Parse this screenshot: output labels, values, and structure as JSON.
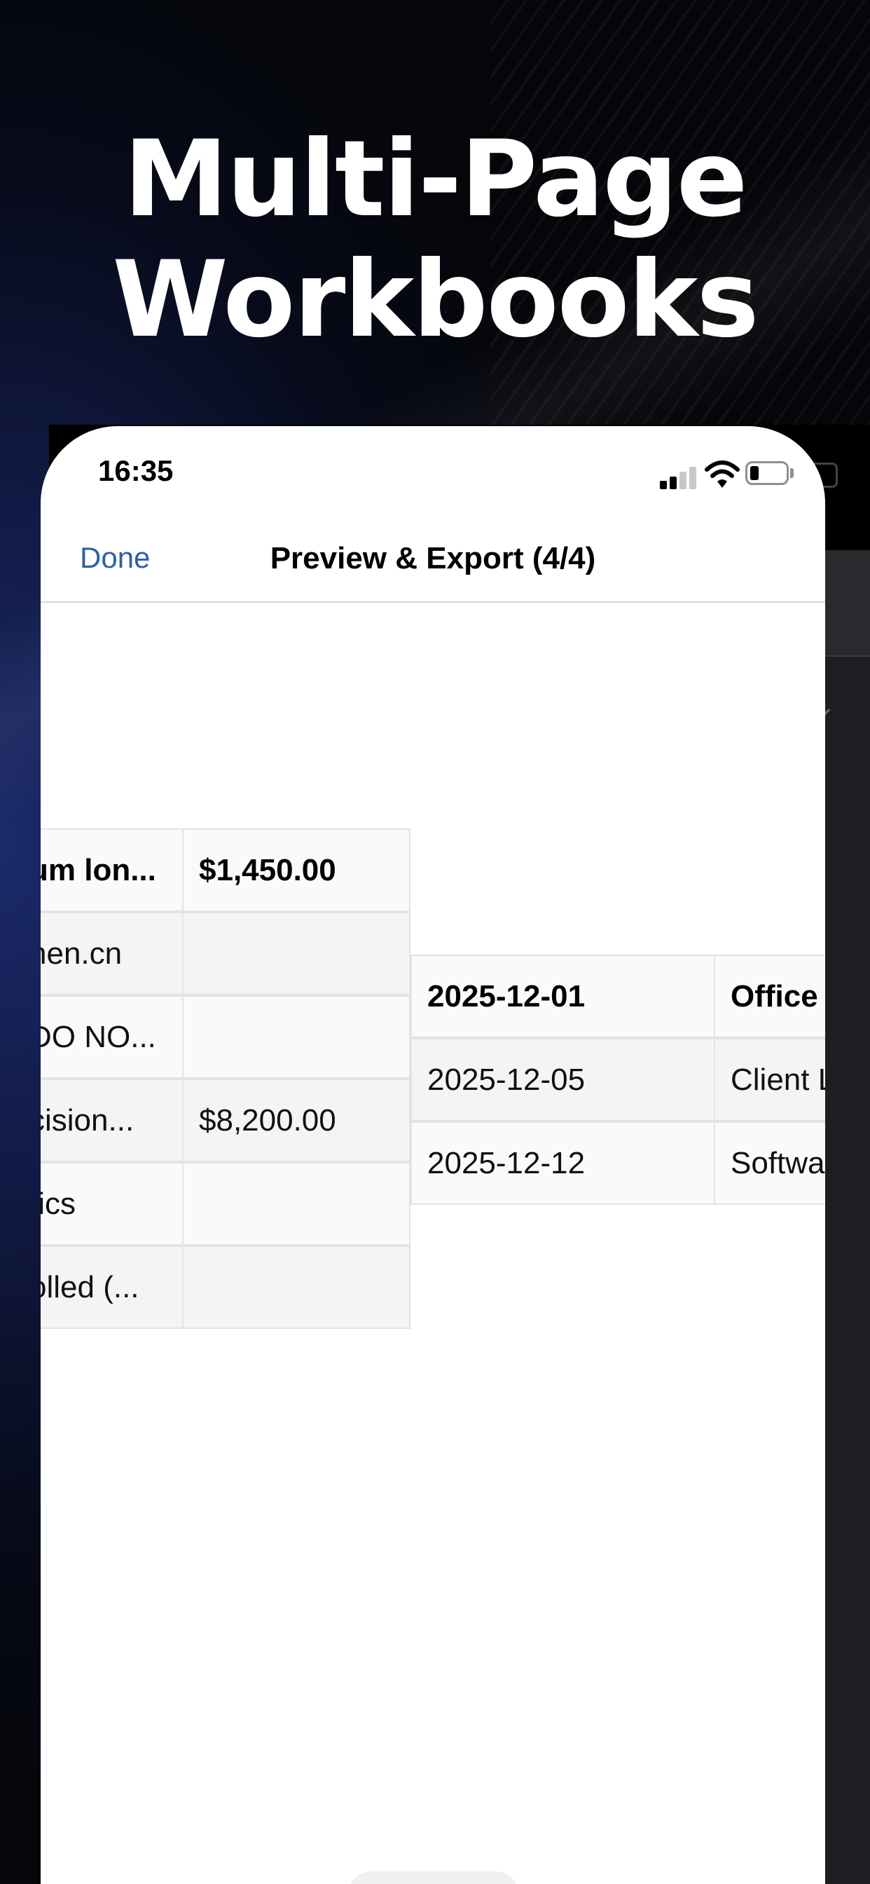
{
  "marketing": {
    "headline_line1": "Multi-Page",
    "headline_line2": "Workbooks"
  },
  "status_bar": {
    "time": "16:35",
    "battery_level": 0.2
  },
  "nav": {
    "done_label": "Done",
    "title": "Preview & Export (4/4)"
  },
  "left_table": {
    "rows": [
      [
        "um lon...",
        "$1,450.00"
      ],
      [
        "nen.cn",
        ""
      ],
      [
        "DO NO...",
        ""
      ],
      [
        "cision...",
        "$8,200.00"
      ],
      [
        "tics",
        ""
      ],
      [
        "olled (...",
        ""
      ]
    ]
  },
  "right_table": {
    "rows": [
      [
        "2025-12-01",
        "Office"
      ],
      [
        "2025-12-05",
        "Client L"
      ],
      [
        "2025-12-12",
        "Softwa"
      ]
    ]
  },
  "pager": {
    "page_count": 4,
    "current_page": 4
  },
  "colors": {
    "link_blue": "#2f5fa8",
    "active_dot": "#1e2f55",
    "inactive_dot": "#b8bfcc"
  }
}
